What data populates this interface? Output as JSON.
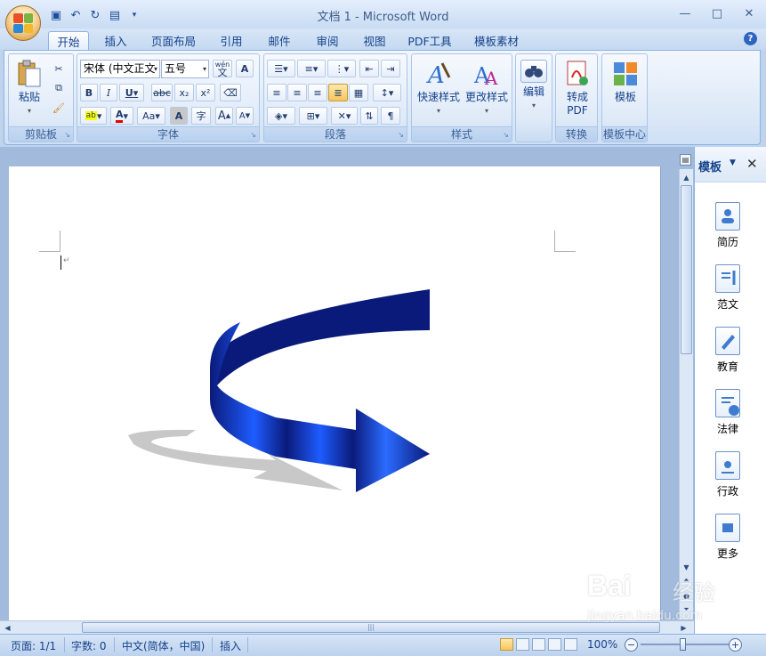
{
  "window": {
    "title": "文档 1 - Microsoft Word",
    "controls": {
      "minimize": "—",
      "maximize": "□",
      "close": "✕"
    }
  },
  "quick_access": [
    "save-icon",
    "undo-icon",
    "redo-icon",
    "print-preview-icon"
  ],
  "tabs": [
    {
      "label": "开始",
      "active": true
    },
    {
      "label": "插入"
    },
    {
      "label": "页面布局"
    },
    {
      "label": "引用"
    },
    {
      "label": "邮件"
    },
    {
      "label": "审阅"
    },
    {
      "label": "视图"
    },
    {
      "label": "PDF工具"
    },
    {
      "label": "模板素材"
    }
  ],
  "ribbon": {
    "clipboard": {
      "label": "剪贴板",
      "paste": "粘贴"
    },
    "font": {
      "label": "字体",
      "font_name": "宋体 (中文正文",
      "font_size": "五号",
      "phonetic": "wén",
      "phonetic_char": "文",
      "bold": "B",
      "italic": "I",
      "underline": "U",
      "strike": "abc",
      "subscript": "x₂",
      "superscript": "x²",
      "case": "Aa",
      "char_shade": "A",
      "enclose": "字",
      "grow": "A",
      "shrink": "A"
    },
    "paragraph": {
      "label": "段落"
    },
    "styles": {
      "label": "样式",
      "quick_styles": "快速样式",
      "change_styles": "更改样式"
    },
    "editing": {
      "label": "编辑"
    },
    "convert": {
      "label": "转换",
      "to_pdf_line1": "转成",
      "to_pdf_line2": "PDF"
    },
    "template_center": {
      "label": "模板中心",
      "template": "模板"
    }
  },
  "task_pane": {
    "title": "模板",
    "items": [
      {
        "label": "简历",
        "icon": "resume-icon"
      },
      {
        "label": "范文",
        "icon": "sample-essay-icon"
      },
      {
        "label": "教育",
        "icon": "education-icon"
      },
      {
        "label": "法律",
        "icon": "law-icon"
      },
      {
        "label": "行政",
        "icon": "admin-icon"
      },
      {
        "label": "更多",
        "icon": "more-icon"
      }
    ]
  },
  "status_bar": {
    "page": "页面: 1/1",
    "words": "字数: 0",
    "language": "中文(简体，中国)",
    "mode": "插入",
    "zoom": "100%"
  },
  "shape": {
    "fill_dark": "#0a1a7a",
    "fill_light": "#1e5cff",
    "shadow": "#c8c8c8"
  },
  "watermark": {
    "brand": "Bai",
    "brand2": "经验",
    "url": "jingyan.baidu.com"
  }
}
